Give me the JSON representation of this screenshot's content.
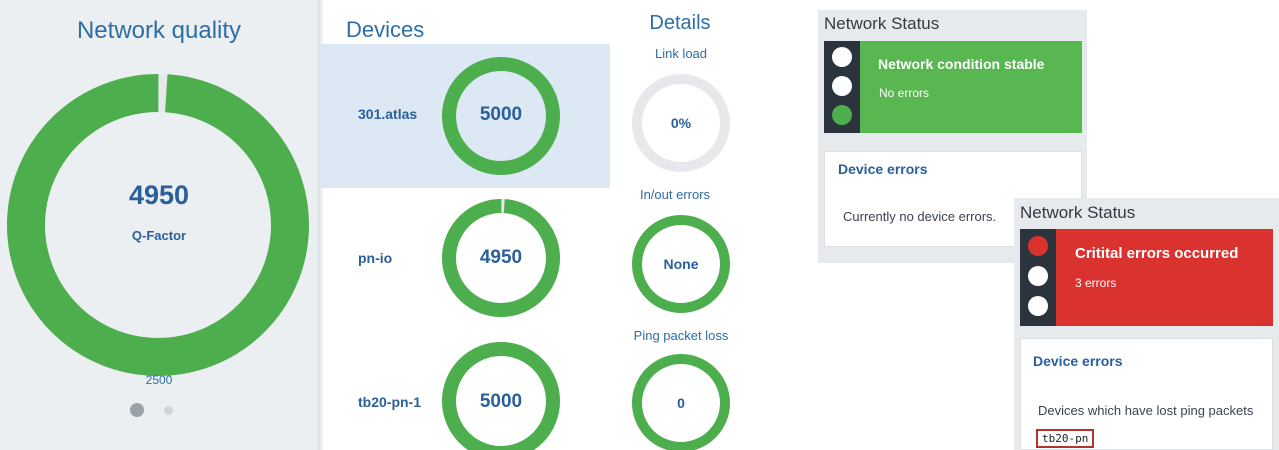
{
  "network_quality": {
    "title": "Network quality",
    "value": "4950",
    "label": "Q-Factor",
    "scale_label": "2500",
    "fill_fraction": 0.99,
    "pager": {
      "page_count": 2,
      "active_index": 0
    }
  },
  "devices": {
    "title": "Devices",
    "selected_index": 0,
    "items": [
      {
        "name": "301.atlas",
        "value": "5000",
        "fill_fraction": 1.0
      },
      {
        "name": "pn-io",
        "value": "4950",
        "fill_fraction": 0.99
      },
      {
        "name": "tb20-pn-1",
        "value": "5000",
        "fill_fraction": 1.0
      }
    ]
  },
  "details": {
    "title": "Details",
    "items": [
      {
        "label": "Link load",
        "value": "0%",
        "fill_fraction": 0.0
      },
      {
        "label": "In/out errors",
        "value": "None",
        "fill_fraction": 1.0
      },
      {
        "label": "Ping packet loss",
        "value": "0",
        "fill_fraction": 1.0
      }
    ]
  },
  "status_cards": [
    {
      "title": "Network Status",
      "band_title": "Network condition stable",
      "band_sub": "No errors",
      "band_color": "#58b751",
      "active_light": "bottom",
      "errors_heading": "Device errors",
      "errors_text": "Currently no device errors."
    },
    {
      "title": "Network Status",
      "band_title": "Critital errors occurred",
      "band_sub": "3 errors",
      "band_color": "#d9322f",
      "active_light": "top",
      "errors_heading": "Device errors",
      "errors_text": "Devices which have lost ping packets",
      "error_device": "tb20-pn"
    }
  ],
  "colors": {
    "ring_green": "#4cae4c",
    "ring_track": "#e6e8eb",
    "title_blue": "#2e6ea6",
    "value_blue": "#2a5f9a",
    "light_green": "#4cae4c",
    "light_red": "#d9322f"
  }
}
